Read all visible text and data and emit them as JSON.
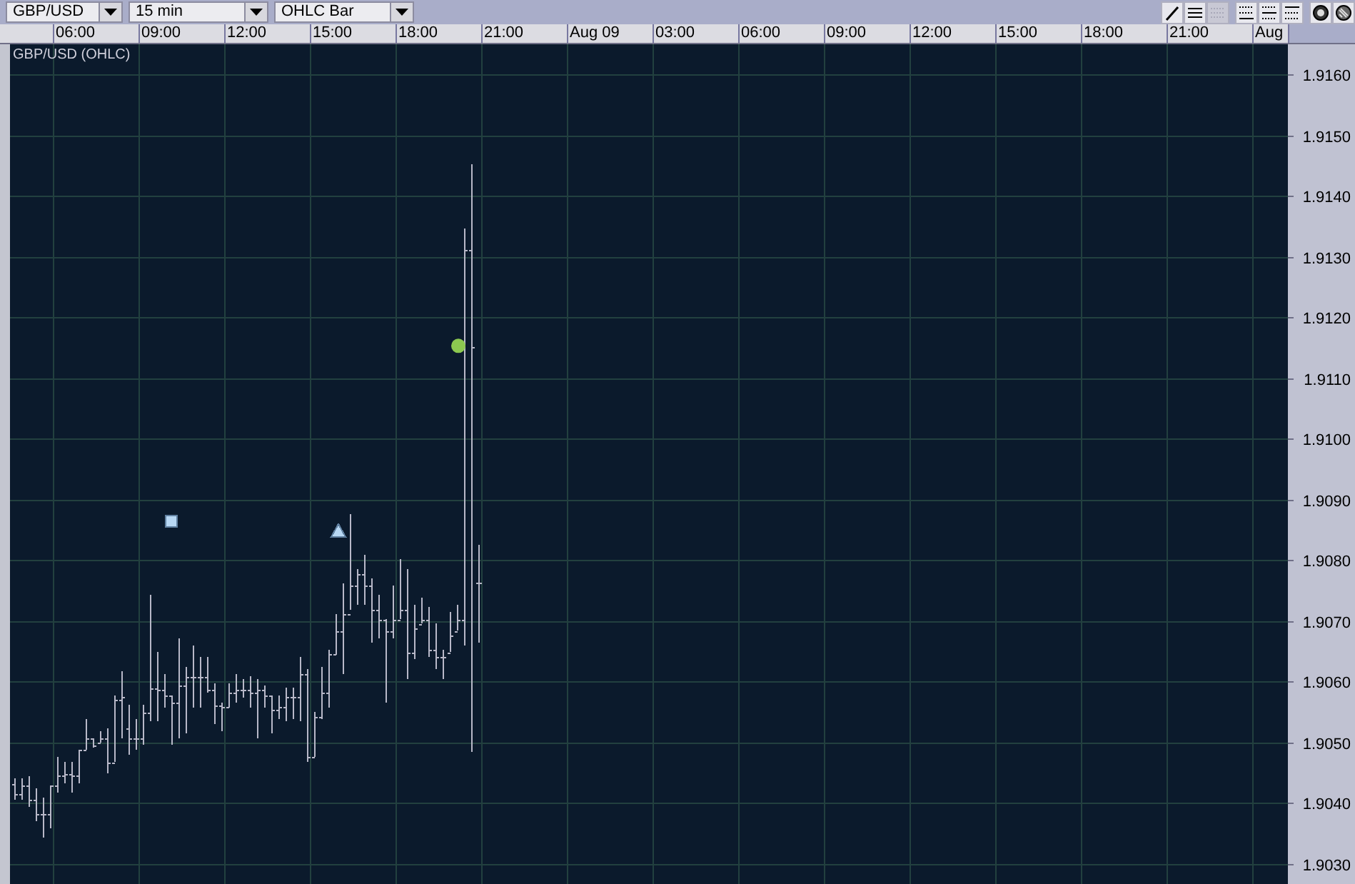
{
  "toolbar": {
    "dropdowns": [
      {
        "kind": "symbol",
        "value": "GBP/USD"
      },
      {
        "kind": "interval",
        "value": "15 min"
      },
      {
        "kind": "chart-type",
        "value": "OHLC Bar"
      }
    ],
    "tool_groups": [
      [
        {
          "kind": "line",
          "disabled": false
        },
        {
          "kind": "lines",
          "disabled": false
        },
        {
          "kind": "lines",
          "disabled": true
        }
      ],
      [
        {
          "kind": "grid-top",
          "disabled": false
        },
        {
          "kind": "grid-middle",
          "disabled": false
        },
        {
          "kind": "grid-bottom",
          "disabled": false
        }
      ],
      [
        {
          "kind": "circle-cross",
          "disabled": false
        },
        {
          "kind": "circle-hatch",
          "disabled": false
        }
      ]
    ]
  },
  "chart": {
    "title": "GBP/USD (OHLC)",
    "time_labels": [
      "06:00",
      "09:00",
      "12:00",
      "15:00",
      "18:00",
      "21:00",
      "Aug 09",
      "03:00",
      "06:00",
      "09:00",
      "12:00",
      "15:00",
      "18:00",
      "21:00",
      "Aug"
    ],
    "price_labels": [
      "1.9160",
      "1.9150",
      "1.9140",
      "1.9130",
      "1.9120",
      "1.9110",
      "1.9100",
      "1.9090",
      "1.9080",
      "1.9070",
      "1.9060",
      "1.9050",
      "1.9040",
      "1.9030"
    ],
    "markers": [
      {
        "kind": "square",
        "color": "#b8d8f4"
      },
      {
        "kind": "triangle",
        "color": "#b8d8f4"
      },
      {
        "kind": "circle",
        "color": "#8cc850"
      }
    ]
  }
}
